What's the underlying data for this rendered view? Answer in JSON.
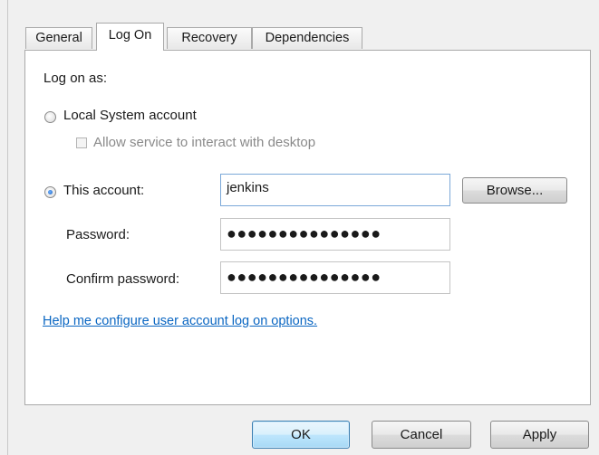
{
  "tabs": [
    {
      "label": "General",
      "active": false
    },
    {
      "label": "Log On",
      "active": true
    },
    {
      "label": "Recovery",
      "active": false
    },
    {
      "label": "Dependencies",
      "active": false
    }
  ],
  "logon": {
    "heading": "Log on as:",
    "local_system": {
      "label": "Local System account",
      "selected": false
    },
    "interact_desktop": {
      "label": "Allow service to interact with desktop",
      "checked": false,
      "enabled": false
    },
    "this_account": {
      "label": "This account:",
      "selected": true,
      "value": "jenkins"
    },
    "browse_label": "Browse...",
    "password": {
      "label": "Password:",
      "value": "●●●●●●●●●●●●●●●"
    },
    "confirm_password": {
      "label": "Confirm password:",
      "value": "●●●●●●●●●●●●●●●"
    },
    "help_link": "Help me configure user account log on options."
  },
  "footer": {
    "ok_label": "OK",
    "cancel_label": "Cancel",
    "apply_label": "Apply"
  },
  "colors": {
    "background": "#f0f0f0",
    "panel": "#ffffff",
    "link": "#0a66c2",
    "radio_selected": "#1c5fbf",
    "focus_border": "#7ba8d8"
  }
}
